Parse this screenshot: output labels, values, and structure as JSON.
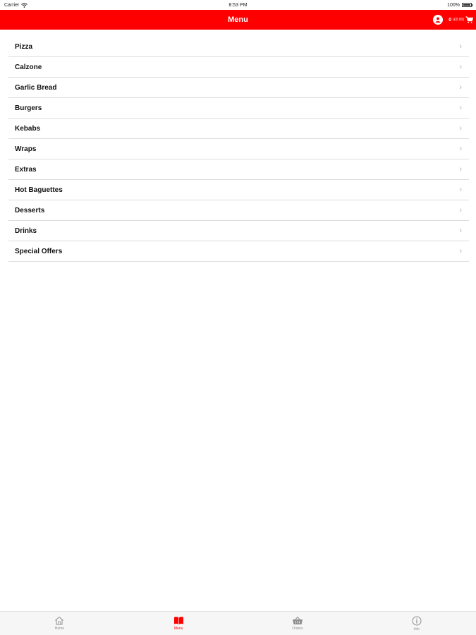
{
  "status_bar": {
    "carrier": "Carrier",
    "time": "8:53 PM",
    "battery": "100%"
  },
  "header": {
    "title": "Menu",
    "cart_count": "0",
    "cart_total": "(£0.00)"
  },
  "menu": {
    "items": [
      {
        "label": "Pizza"
      },
      {
        "label": "Calzone"
      },
      {
        "label": "Garlic Bread"
      },
      {
        "label": "Burgers"
      },
      {
        "label": "Kebabs"
      },
      {
        "label": "Wraps"
      },
      {
        "label": "Extras"
      },
      {
        "label": "Hot Baguettes"
      },
      {
        "label": "Desserts"
      },
      {
        "label": "Drinks"
      },
      {
        "label": "Special Offers"
      }
    ]
  },
  "tab_bar": {
    "tabs": [
      {
        "label": "Home",
        "icon": "home-icon"
      },
      {
        "label": "Menu",
        "icon": "book-icon",
        "active": true
      },
      {
        "label": "Orders",
        "icon": "basket-icon"
      },
      {
        "label": "Info",
        "icon": "info-icon"
      }
    ]
  },
  "colors": {
    "accent": "#fe0000",
    "inactive": "#8e8e8e"
  }
}
